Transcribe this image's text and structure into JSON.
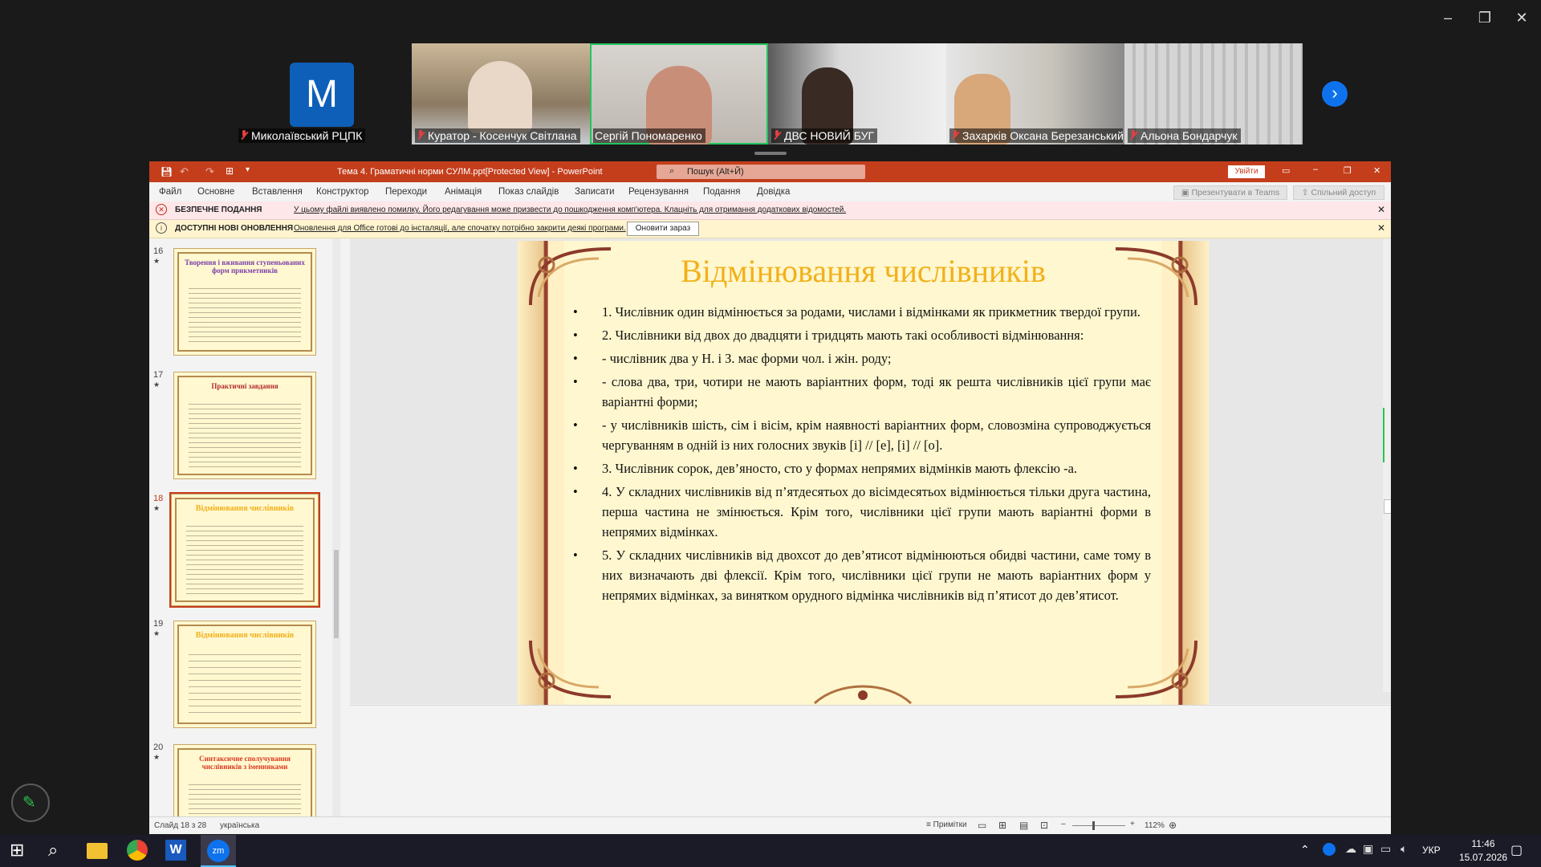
{
  "gallery": {
    "participants": [
      {
        "name": "Миколаївський РЦПК",
        "avatar_letter": "M",
        "muted": true
      },
      {
        "name": "Куратор - Косенчук Світлана",
        "muted": true
      },
      {
        "name": "Сергій Пономаренко",
        "muted": false,
        "active_speaker": true
      },
      {
        "name": "ДВС НОВИЙ БУГ",
        "muted": true
      },
      {
        "name": "Захарків Оксана Березанський ...",
        "muted": true
      },
      {
        "name": "Альона Бондарчук",
        "muted": true
      }
    ]
  },
  "ppt": {
    "window_title": "Тема 4. Граматичні норми СУЛМ.ppt[Protected View] - PowerPoint",
    "search_placeholder": "Пошук (Alt+Й)",
    "signin_label": "Увійти",
    "tabs": [
      "Файл",
      "Основне",
      "Вставлення",
      "Конструктор",
      "Переходи",
      "Анімація",
      "Показ слайдів",
      "Записати",
      "Рецензування",
      "Подання",
      "Довідка"
    ],
    "present_teams_label": "Презентувати в Teams",
    "share_label": "Спільний доступ",
    "msg_protected": {
      "title": "БЕЗПЕЧНЕ ПОДАННЯ",
      "text": "У цьому файлі виявлено помилку. Його редагування може призвести до пошкодження комп'ютера. Клацніть для отримання додаткових відомостей."
    },
    "msg_updates": {
      "title": "ДОСТУПНІ НОВІ ОНОВЛЕННЯ",
      "text": "Оновлення для Office готові до інсталяції, але спочатку потрібно закрити деякі програми.",
      "button": "Оновити зараз"
    },
    "thumbnails": [
      {
        "number": "16",
        "title": "Творення і вживання ступеньованих форм прикметників",
        "title_color": "#7a3ea8"
      },
      {
        "number": "17",
        "title": "Практичні завдання",
        "title_color": "#b32a2a"
      },
      {
        "number": "18",
        "title": "Відмінювання числівників",
        "title_color": "#f2b019",
        "selected": true
      },
      {
        "number": "19",
        "title": "Відмінювання числівників",
        "title_color": "#f2b019"
      },
      {
        "number": "20",
        "title": "Синтаксичне сполучування числівників з іменниками",
        "title_color": "#d9381e"
      }
    ],
    "slide": {
      "title": "Відмінювання числівників",
      "bullets": [
        "1. Числівник один відмінюється за родами, числами і відмінками як прикметник твердої групи.",
        "2. Числівники від двох до двадцяти і тридцять мають такі особливості відмінювання:",
        "- числівник два у Н. і З. має форми чол. і жін. роду;",
        "- слова два, три, чотири не мають варіантних форм, тоді як решта числівників цієї групи має варіантні форми;",
        "- у числівників шість, сім і вісім, крім наявності варіантних форм, словозміна супроводжується чергуванням в одній із них голосних звуків [і] // [е], [і] // [о].",
        "3. Числівник сорок, дев’яносто, сто у формах непрямих відмінків мають флексію -а.",
        "4. У складних числівників від п’ятдесятьох до вісімдесятьох відмінюється тільки друга частина, перша частина не змінюється. Крім того, числівники цієї групи мають варіантні форми в непрямих відмінках.",
        "5. У складних числівників від двохсот до дев’ятисот відмінюються обидві частини, саме тому в них визначають дві флексії. Крім того, числівники цієї групи не мають варіантних форм у непрямих відмінках, за винятком орудного відмінка числівників від п’ятисот до дев’ятисот."
      ]
    },
    "status": {
      "slide_counter": "Слайд 18 з 28",
      "language": "українська",
      "notes_label": "Примітки",
      "zoom": "112%"
    }
  },
  "taskbar": {
    "language": "УКР",
    "time": "11:46",
    "date": "15.07.2026"
  },
  "colors": {
    "ppt_accent": "#c43e1c",
    "zoom_blue": "#0e72ed",
    "slide_title": "#f2b019"
  }
}
